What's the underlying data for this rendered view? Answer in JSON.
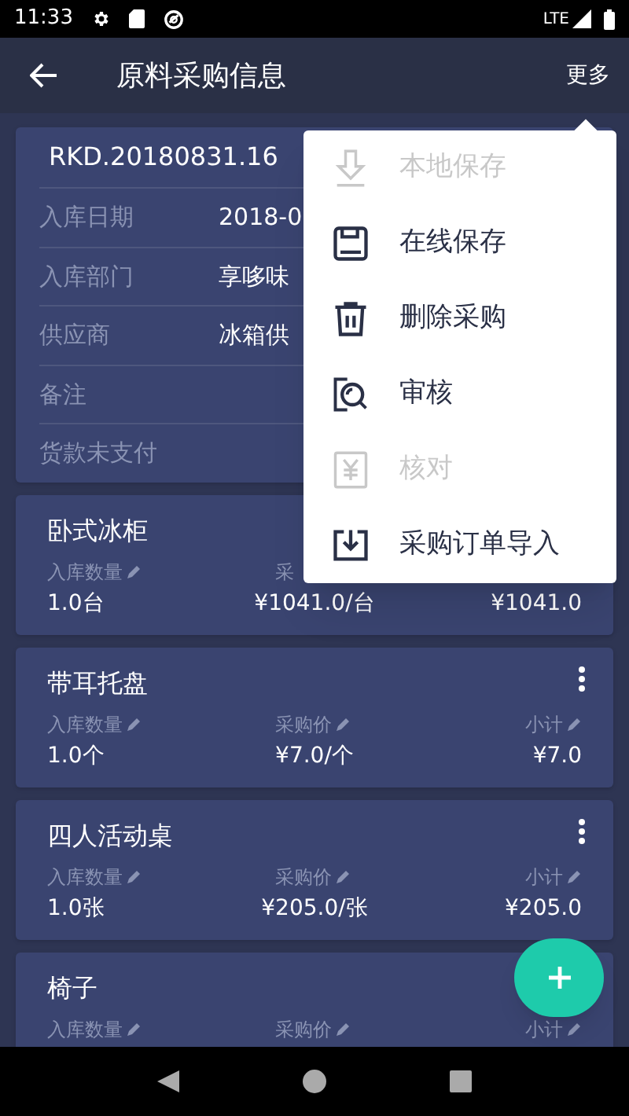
{
  "status_bar": {
    "time": "11:33",
    "network": "LTE"
  },
  "app_bar": {
    "title": "原料采购信息",
    "action": "更多"
  },
  "header": {
    "doc_no": "RKD.20180831.16",
    "fields": [
      {
        "label": "入库日期",
        "value": "2018-0"
      },
      {
        "label": "入库部门",
        "value": "享哆味"
      },
      {
        "label": "供应商",
        "value": "冰箱供"
      },
      {
        "label": "备注"
      },
      {
        "label": "货款未支付"
      }
    ]
  },
  "items": [
    {
      "name": "卧式冰柜",
      "columns": [
        {
          "label": "入库数量",
          "editable": true,
          "value": "1.0台"
        },
        {
          "label": "采",
          "editable": false,
          "value": "¥1041.0/台"
        },
        {
          "value": "¥1041.0"
        }
      ]
    },
    {
      "name": "带耳托盘",
      "more": true,
      "columns": [
        {
          "label": "入库数量",
          "editable": true,
          "value": "1.0个"
        },
        {
          "label": "采购价",
          "editable": true,
          "value": "¥7.0/个"
        },
        {
          "label": "小计",
          "editable": true,
          "value": "¥7.0"
        }
      ]
    },
    {
      "name": "四人活动桌",
      "more": true,
      "columns": [
        {
          "label": "入库数量",
          "editable": true,
          "value": "1.0张"
        },
        {
          "label": "采购价",
          "editable": true,
          "value": "¥205.0/张"
        },
        {
          "label": "小计",
          "editable": true,
          "value": "¥205.0"
        }
      ]
    },
    {
      "name": "椅子",
      "columns": [
        {
          "label": "入库数量",
          "editable": true
        },
        {
          "label": "采购价",
          "editable": true
        },
        {
          "label": "小计",
          "editable": true
        }
      ]
    }
  ],
  "menu": [
    {
      "kind": "download",
      "label": "本地保存",
      "disabled": true
    },
    {
      "kind": "save",
      "label": "在线保存",
      "disabled": false
    },
    {
      "kind": "trash",
      "label": "删除采购",
      "disabled": false
    },
    {
      "kind": "review",
      "label": "审核",
      "disabled": false
    },
    {
      "kind": "yen",
      "label": "核对",
      "disabled": true
    },
    {
      "kind": "import",
      "label": "采购订单导入",
      "disabled": false
    }
  ]
}
